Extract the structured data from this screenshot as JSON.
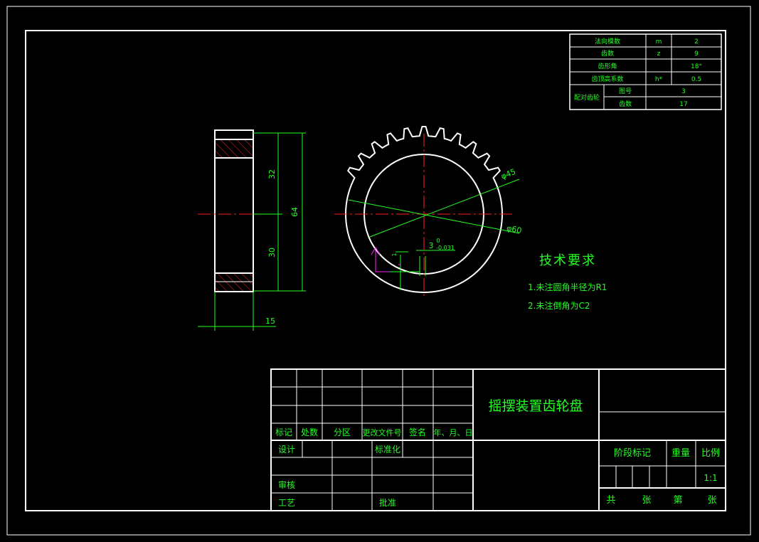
{
  "colors": {
    "background": "#000000",
    "outline": "#ffffff",
    "text": "#22ff22",
    "centerline": "#ff2222",
    "hatch": "#ff2222",
    "dimension": "#22ff22",
    "keyway": "#ff22ff"
  },
  "param_table": {
    "rows": [
      {
        "label": "法向模数",
        "symbol": "m",
        "value": "2"
      },
      {
        "label": "齿数",
        "symbol": "z",
        "value": "9"
      },
      {
        "label": "齿形角",
        "symbol": "",
        "value": "18°"
      },
      {
        "label": "齿顶高系数",
        "symbol": "h*",
        "value": "0.5"
      }
    ],
    "mating_label": "配对齿轮",
    "mating_rows": [
      {
        "label": "图号",
        "value": "3"
      },
      {
        "label": "齿数",
        "value": "17"
      }
    ]
  },
  "side_view": {
    "dim_upper": "32",
    "dim_lower": "30",
    "dim_total": "64",
    "dim_width": "15"
  },
  "front_view": {
    "dim_bore": "φ45",
    "dim_root": "φ60",
    "key_upper": "0",
    "key_nominal": "3",
    "key_lower": "-0.031",
    "key_small": "1"
  },
  "tech": {
    "title": "技术要求",
    "items": [
      "1.未注圆角半径为R1",
      "2.未注倒角为C2"
    ]
  },
  "title_block": {
    "part_name": "摇摆装置齿轮盘",
    "rev_headers": [
      "标记",
      "处数",
      "分区",
      "更改文件号",
      "签名",
      "年、月、日"
    ],
    "design": "设计",
    "standardize": "标准化",
    "review": "审核",
    "process": "工艺",
    "approve": "批准",
    "stage": "阶段标记",
    "weight": "重量",
    "scale": "比例",
    "scale_value": "1:1",
    "sheet_total": "共",
    "sheet_word": "张",
    "sheet_num": "第",
    "sheet_word2": "张"
  }
}
